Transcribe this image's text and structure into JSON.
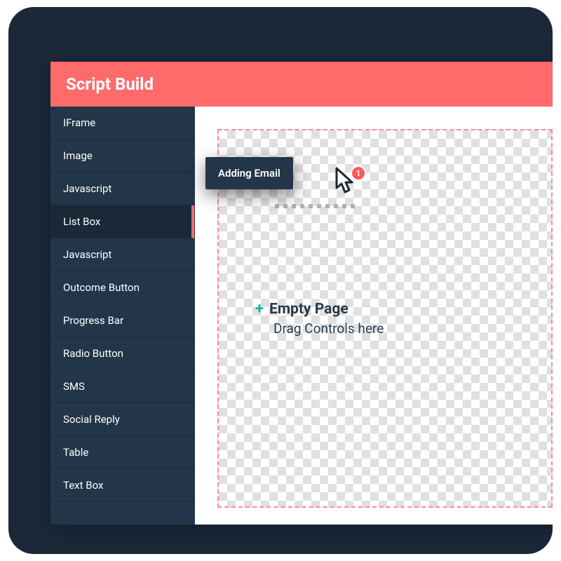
{
  "header": {
    "title": "Script Build"
  },
  "sidebar": {
    "items": [
      {
        "label": "IFrame"
      },
      {
        "label": "Image"
      },
      {
        "label": "Javascript"
      },
      {
        "label": "List Box",
        "active": true
      },
      {
        "label": "Javascript"
      },
      {
        "label": "Outcome Button"
      },
      {
        "label": "Progress Bar"
      },
      {
        "label": "Radio Button"
      },
      {
        "label": "SMS"
      },
      {
        "label": "Social Reply"
      },
      {
        "label": "Table"
      },
      {
        "label": "Text Box"
      }
    ]
  },
  "canvas": {
    "title": "Empty Page",
    "subtitle": "Drag Controls here",
    "plus_symbol": "+"
  },
  "drag": {
    "tooltip": "Adding Email",
    "badge_count": "1"
  },
  "colors": {
    "accent": "#ff6b6b",
    "dark": "#1a2838",
    "sidebar": "#223549",
    "teal": "#15b8a4"
  }
}
